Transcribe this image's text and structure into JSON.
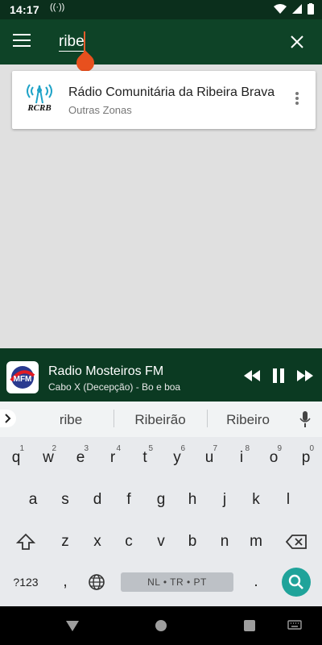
{
  "status": {
    "time": "14:17"
  },
  "search": {
    "query": "ribe"
  },
  "results": [
    {
      "title": "Rádio Comunitária da Ribeira Brava",
      "subtitle": "Outras Zonas",
      "logo_text": "RCRB"
    }
  ],
  "player": {
    "station": "Radio Mosteiros FM",
    "track": "Cabo X (Decepção) - Bo e boa",
    "logo_text": "MFM"
  },
  "suggestions": [
    "ribe",
    "Ribeirão",
    "Ribeiro"
  ],
  "keyboard": {
    "row1": [
      "q",
      "w",
      "e",
      "r",
      "t",
      "y",
      "u",
      "i",
      "o",
      "p"
    ],
    "row1_hints": [
      "1",
      "2",
      "3",
      "4",
      "5",
      "6",
      "7",
      "8",
      "9",
      "0"
    ],
    "row2": [
      "a",
      "s",
      "d",
      "f",
      "g",
      "h",
      "j",
      "k",
      "l"
    ],
    "row3": [
      "z",
      "x",
      "c",
      "v",
      "b",
      "n",
      "m"
    ],
    "symbols_label": "?123",
    "comma": ",",
    "period": ".",
    "space_label": "NL • TR • PT"
  },
  "colors": {
    "appbar": "#0e4327",
    "accent": "#e8501e",
    "search_key": "#1fa39a"
  }
}
